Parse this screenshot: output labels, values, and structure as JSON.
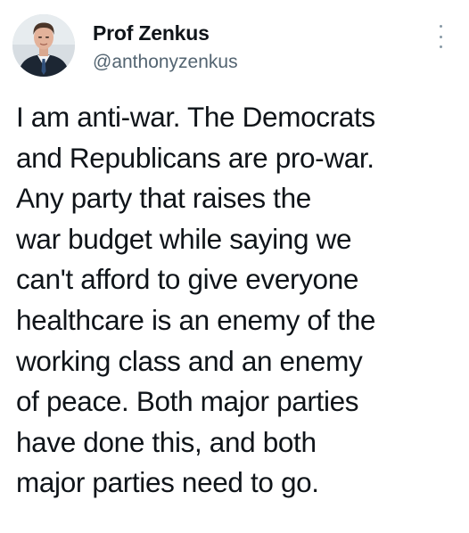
{
  "author": {
    "display_name": "Prof Zenkus",
    "handle": "@anthonyzenkus"
  },
  "tweet": {
    "lines": [
      "I am anti-war. The Democrats",
      "and Republicans are pro-war.",
      "Any party that raises the",
      "war budget while saying we",
      "can't afford to give everyone",
      "healthcare is an enemy of the",
      "working class and an enemy",
      "of peace. Both major parties",
      "have done this, and both",
      "major parties need to go."
    ]
  },
  "icons": {
    "more": "more-vertical-icon"
  },
  "colors": {
    "text": "#0f1419",
    "secondary": "#536471",
    "background": "#ffffff"
  }
}
